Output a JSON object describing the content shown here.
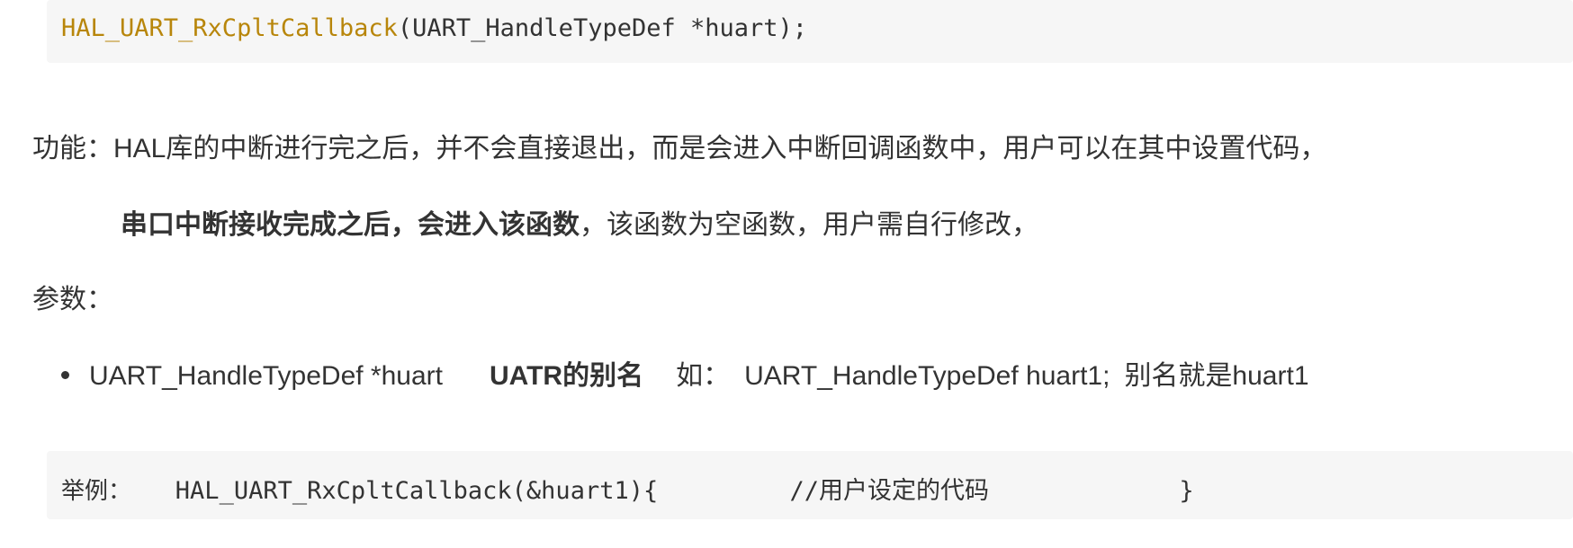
{
  "top_code": {
    "fn_name": "HAL_UART_RxCpltCallback",
    "rest": "(UART_HandleTypeDef *huart);"
  },
  "paragraph1": "功能：HAL库的中断进行完之后，并不会直接退出，而是会进入中断回调函数中，用户可以在其中设置代码，",
  "paragraph2": {
    "bold": "串口中断接收完成之后，会进入该函数",
    "normal": "，该函数为空函数，用户需自行修改，"
  },
  "paragraph3": "参数：",
  "bullet": {
    "param": "UART_HandleTypeDef *huart",
    "bold_desc": "UATR的别名",
    "example_label": "如：",
    "example_code": "UART_HandleTypeDef huart1;",
    "alias_note": "别名就是huart1"
  },
  "bottom_code": {
    "label": "举例：",
    "call": "HAL_UART_RxCpltCallback(&huart1){",
    "comment": "//用户设定的代码",
    "close": "}"
  }
}
